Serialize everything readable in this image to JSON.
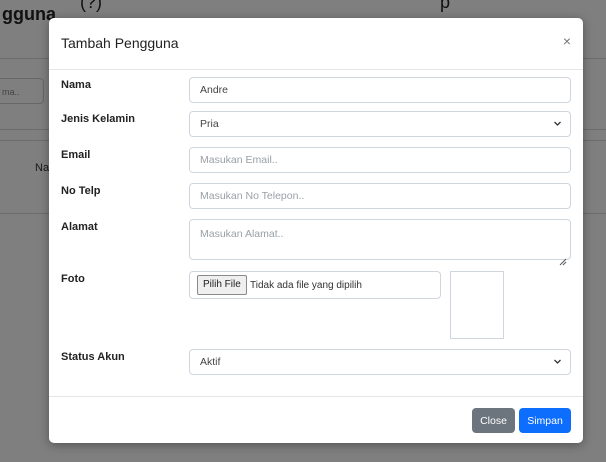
{
  "background": {
    "heading": "gguna",
    "top_text_1": "(?)",
    "top_text_2": "p",
    "search_placeholder": "ma..",
    "column_header": "Nam"
  },
  "modal": {
    "title": "Tambah Pengguna",
    "close_symbol": "×",
    "fields": {
      "nama": {
        "label": "Nama",
        "value": "Andre"
      },
      "jenis_kelamin": {
        "label": "Jenis Kelamin",
        "selected": "Pria"
      },
      "email": {
        "label": "Email",
        "placeholder": "Masukan Email.."
      },
      "no_telp": {
        "label": "No Telp",
        "placeholder": "Masukan No Telepon.."
      },
      "alamat": {
        "label": "Alamat",
        "placeholder": "Masukan Alamat.."
      },
      "foto": {
        "label": "Foto",
        "button_label": "Pilih File",
        "file_status": "Tidak ada file yang dipilih"
      },
      "status_akun": {
        "label": "Status Akun",
        "selected": "Aktif"
      }
    },
    "footer": {
      "close_label": "Close",
      "save_label": "Simpan"
    }
  },
  "colors": {
    "primary": "#0d6efd",
    "secondary": "#6c757d",
    "backdrop": "rgba(0,0,0,0.5)"
  },
  "icons": {
    "close": "close-icon",
    "select_arrow": "chevron-down-icon",
    "textarea_resize": "resize-handle-icon"
  }
}
